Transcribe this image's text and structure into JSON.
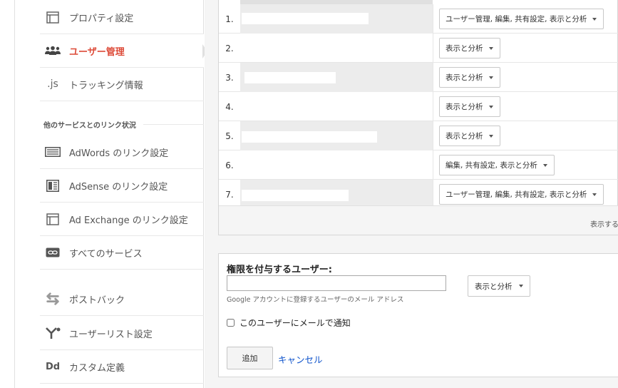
{
  "sidebar": {
    "items": [
      {
        "label": "プロパティ設定",
        "icon": "property-settings-icon",
        "active": false
      },
      {
        "label": "ユーザー管理",
        "icon": "users-icon",
        "active": true
      },
      {
        "label": "トラッキング情報",
        "icon": "js-icon",
        "active": false
      }
    ],
    "section_title": "他のサービスとのリンク状況",
    "links": [
      {
        "label": "AdWords のリンク設定",
        "icon": "adwords-icon"
      },
      {
        "label": "AdSense のリンク設定",
        "icon": "adsense-icon"
      },
      {
        "label": "Ad Exchange のリンク設定",
        "icon": "ad-exchange-icon"
      },
      {
        "label": "すべてのサービス",
        "icon": "link-icon"
      },
      {
        "label": "ポストバック",
        "icon": "postback-icon"
      },
      {
        "label": "ユーザーリスト設定",
        "icon": "user-list-icon"
      },
      {
        "label": "カスタム定義",
        "icon": "dd-icon"
      }
    ],
    "js_glyph": ".js",
    "dd_glyph": "Dd"
  },
  "users_table": {
    "rows": [
      {
        "num": "1.",
        "permission": "ユーザー管理, 編集, 共有設定, 表示と分析"
      },
      {
        "num": "2.",
        "permission": "表示と分析"
      },
      {
        "num": "3.",
        "permission": "表示と分析"
      },
      {
        "num": "4.",
        "permission": "表示と分析"
      },
      {
        "num": "5.",
        "permission": "表示と分析"
      },
      {
        "num": "6.",
        "permission": "編集, 共有設定, 表示と分析"
      },
      {
        "num": "7.",
        "permission": "ユーザー管理, 編集, 共有設定, 表示と分析"
      }
    ],
    "footer_text": "表示する"
  },
  "add_user": {
    "title": "権限を付与するユーザー:",
    "email_value": "",
    "email_help": "Google アカウントに登録するユーザーのメール アドレス",
    "permission_selected": "表示と分析",
    "notify_label": "このユーザーにメールで通知",
    "notify_checked": false,
    "add_label": "追加",
    "cancel_label": "キャンセル"
  },
  "colors": {
    "active": "#dd4b39",
    "link": "#1155cc"
  }
}
